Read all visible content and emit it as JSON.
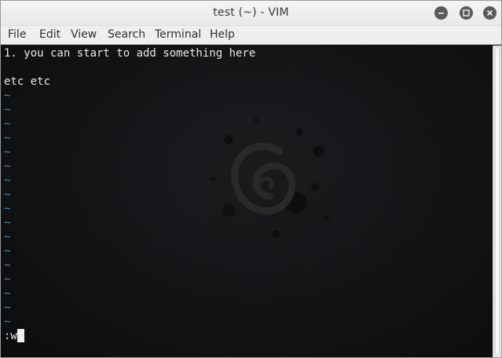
{
  "window": {
    "title": "test (~) - VIM"
  },
  "menu": {
    "items": [
      "File",
      "Edit",
      "View",
      "Search",
      "Terminal",
      "Help"
    ]
  },
  "editor": {
    "lines": [
      "1. you can start to add something here",
      "",
      "etc etc"
    ],
    "empty_line_marker": "~",
    "command_line": ":w"
  },
  "icons": {
    "minimize": "minimize-icon",
    "maximize": "maximize-icon",
    "close": "close-icon"
  },
  "colors": {
    "tilde": "#4a8fb0",
    "background": "#0f1113",
    "text": "#e8e8e8"
  }
}
